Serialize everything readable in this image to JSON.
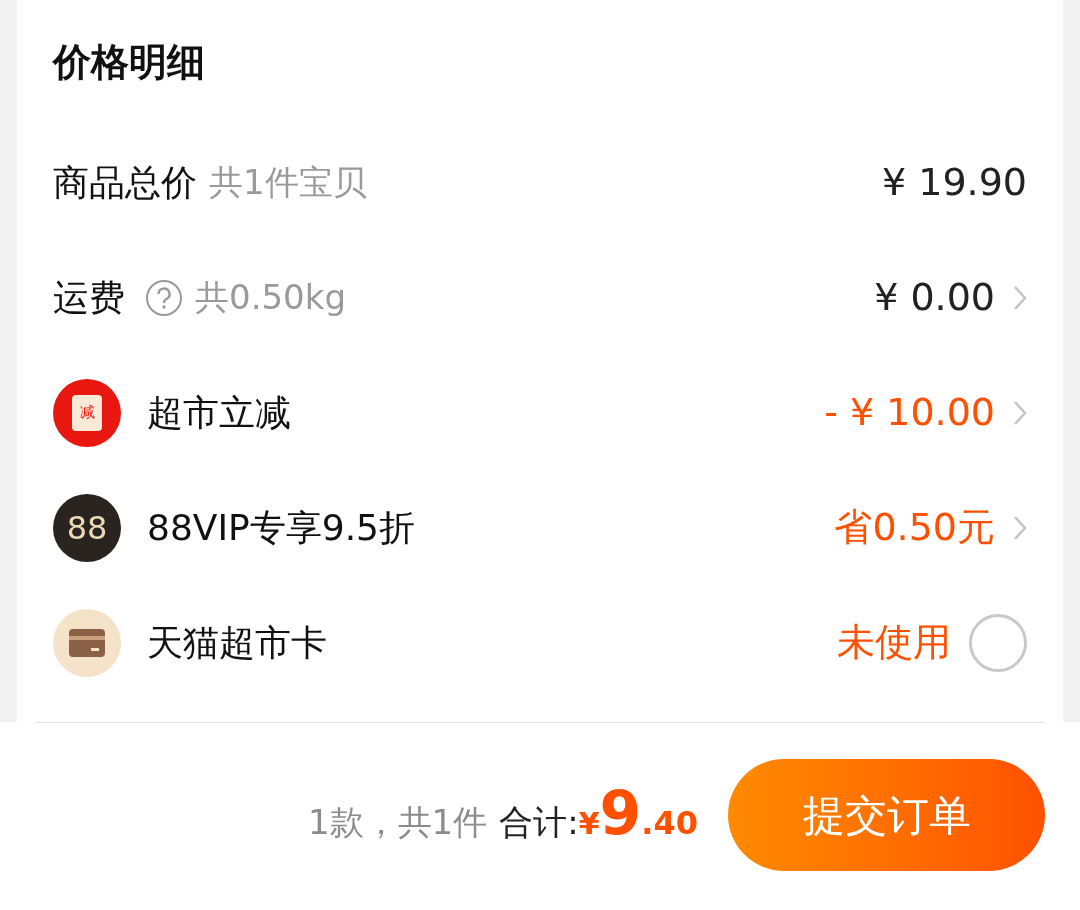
{
  "title": "价格明细",
  "rows": [
    {
      "kind": "plain",
      "label": "商品总价",
      "note": "共1件宝贝",
      "value": "¥ 19.90",
      "accent": false,
      "chevron": false
    },
    {
      "kind": "help",
      "label": "运费",
      "note": "共0.50kg",
      "value": "¥ 0.00",
      "accent": false,
      "chevron": true
    },
    {
      "kind": "discount",
      "badge_text": "减",
      "label": "超市立减",
      "value": "- ¥ 10.00",
      "accent": true,
      "chevron": true
    },
    {
      "kind": "vip",
      "badge_text": "88",
      "label": "88VIP专享9.5折",
      "value": "省0.50元",
      "accent": true,
      "chevron": true
    },
    {
      "kind": "card",
      "label": "天猫超市卡",
      "value": "未使用",
      "accent": true,
      "chevron": false,
      "checked": false
    }
  ],
  "footer": {
    "count": "1款，共1件",
    "total_label": "合计:",
    "currency": "¥",
    "total_int": "9",
    "total_dec": ".40",
    "submit": "提交订单"
  }
}
